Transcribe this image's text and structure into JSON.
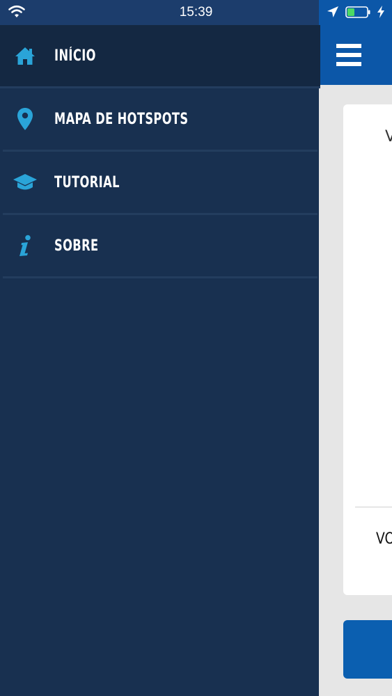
{
  "status_bar": {
    "time": "15:39"
  },
  "drawer": {
    "items": [
      {
        "label": "INÍCIO",
        "icon": "home-icon"
      },
      {
        "label": "MAPA DE HOTSPOTS",
        "icon": "map-pin-icon"
      },
      {
        "label": "TUTORIAL",
        "icon": "graduation-cap-icon"
      },
      {
        "label": "SOBRE",
        "icon": "info-icon"
      }
    ]
  },
  "content": {
    "card_top_text": "V",
    "card_bottom_text": "VO"
  },
  "colors": {
    "drawer_bg": "#183050",
    "active_item_bg": "#142842",
    "icon_accent": "#2aa4d8",
    "header_blue": "#0c57a8"
  }
}
